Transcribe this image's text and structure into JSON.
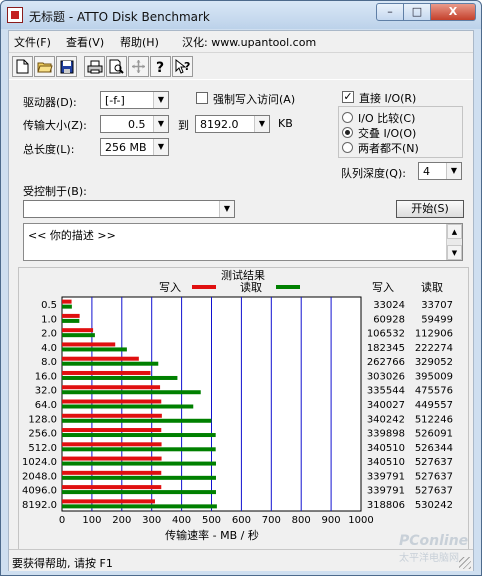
{
  "window": {
    "title": "无标题 - ATTO Disk Benchmark",
    "minimize_label": "–",
    "maximize_label": "□",
    "close_label": "X"
  },
  "menu": {
    "items": [
      {
        "label": "文件(F)"
      },
      {
        "label": "查看(V)"
      },
      {
        "label": "帮助(H)"
      },
      {
        "label": "汉化: www.upantool.com"
      }
    ]
  },
  "toolbar": {
    "icons": [
      "new-file-icon",
      "open-folder-icon",
      "save-icon",
      "print-icon",
      "print-preview-icon",
      "move-icon",
      "help-icon",
      "context-help-icon"
    ]
  },
  "settings": {
    "drive_label": "驱动器(D):",
    "drive_value": "[-f-]",
    "transfer_label": "传输大小(Z):",
    "transfer_from": "0.5",
    "to_label": "到",
    "transfer_to": "8192.0",
    "kb_label": "KB",
    "total_label": "总长度(L):",
    "total_value": "256 MB",
    "force_write_label": "强制写入访问(A)",
    "force_write_checked": false,
    "direct_io_label": "直接 I/O(R)",
    "direct_io_checked": true,
    "io_compare_label": "I/O 比较(C)",
    "overlap_io_label": "交叠 I/O(O)",
    "neither_label": "两者都不(N)",
    "selected_mode": "overlap",
    "queue_label": "队列深度(Q):",
    "queue_value": "4",
    "controlled_label": "受控制于(B):",
    "controlled_value": "",
    "start_label": "开始(S)"
  },
  "description": {
    "text": "<<   你的描述    >>"
  },
  "results": {
    "title": "测试结果",
    "write_legend": "写入",
    "read_legend": "读取",
    "col_write": "写入",
    "col_read": "读取",
    "xlabel": "传输速率 - MB / 秒"
  },
  "colors": {
    "write": "#e01010",
    "read": "#008000",
    "grid": "#1010d0"
  },
  "chart_data": {
    "type": "bar",
    "orientation": "horizontal",
    "title": "测试结果",
    "xlabel": "传输速率 - MB / 秒",
    "xlim": [
      0,
      1000
    ],
    "xticks": [
      0,
      100,
      200,
      300,
      400,
      500,
      600,
      700,
      800,
      900,
      1000
    ],
    "categories": [
      "0.5",
      "1.0",
      "2.0",
      "4.0",
      "8.0",
      "16.0",
      "32.0",
      "64.0",
      "128.0",
      "256.0",
      "512.0",
      "1024.0",
      "2048.0",
      "4096.0",
      "8192.0"
    ],
    "series": [
      {
        "name": "写入",
        "values": [
          32,
          59,
          104,
          178,
          257,
          296,
          328,
          332,
          334,
          332,
          333,
          333,
          332,
          332,
          311
        ]
      },
      {
        "name": "读取",
        "values": [
          33,
          58,
          110,
          217,
          322,
          386,
          464,
          439,
          500,
          514,
          514,
          515,
          515,
          515,
          518
        ]
      }
    ],
    "write_kb": [
      33024,
      60928,
      106532,
      182345,
      262766,
      303026,
      335544,
      340027,
      340242,
      339898,
      340510,
      340510,
      339791,
      339791,
      318806
    ],
    "read_kb": [
      33707,
      59499,
      112906,
      222274,
      329052,
      395009,
      475576,
      449557,
      512246,
      526091,
      526344,
      527637,
      527637,
      527637,
      530242
    ],
    "grid": true,
    "legend": "top"
  },
  "status": {
    "text": "要获得帮助, 请按 F1"
  },
  "watermark": {
    "line1": "PConline",
    "line2": "太平洋电脑网"
  }
}
